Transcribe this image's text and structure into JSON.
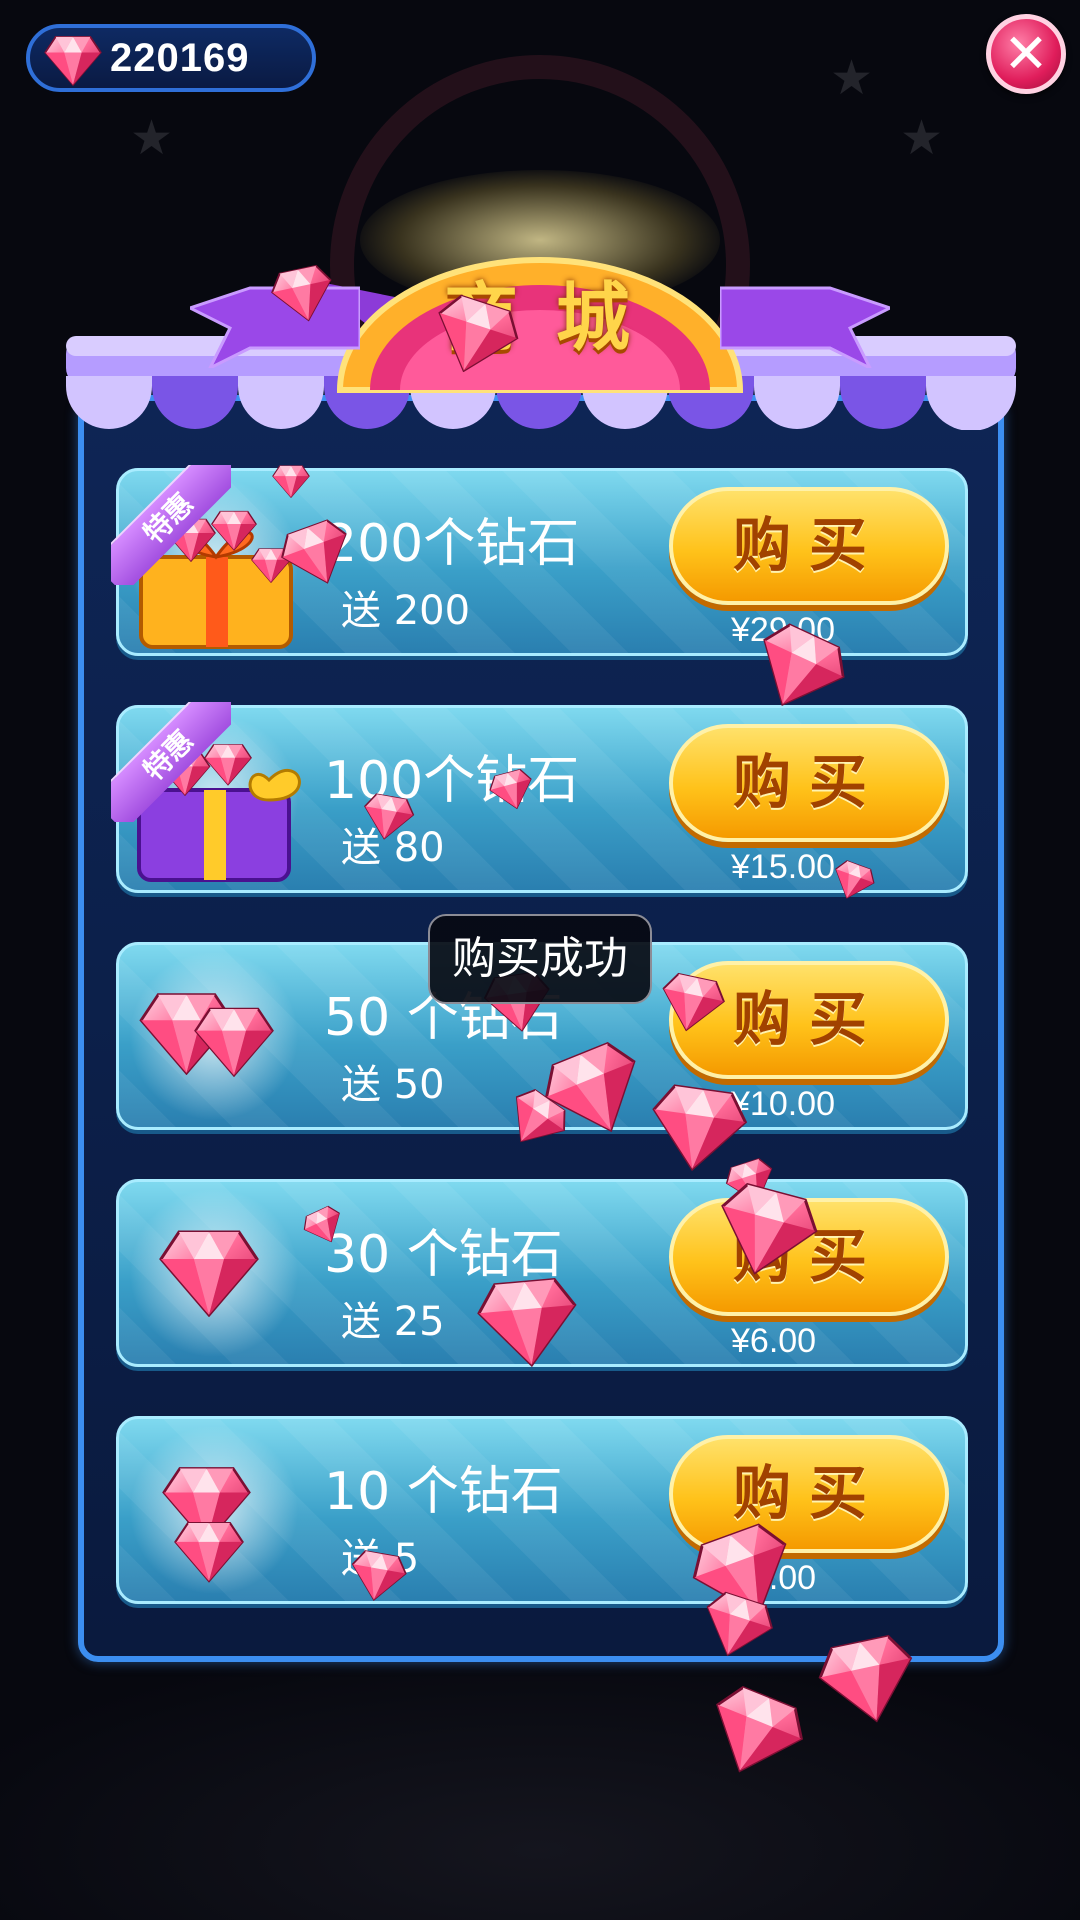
{
  "hud": {
    "gem_count": "220169"
  },
  "shop": {
    "title": "商 城",
    "offers": [
      {
        "quantity": "200个钻石",
        "bonus": "送 200",
        "buy_label": "购买",
        "price": "¥29.00",
        "badge": "特惠"
      },
      {
        "quantity": "100个钻石",
        "bonus": "送 80",
        "buy_label": "购买",
        "price": "¥15.00",
        "badge": "特惠"
      },
      {
        "quantity": "50 个钻石",
        "bonus": "送 50",
        "buy_label": "购买",
        "price": "¥10.00",
        "badge": ""
      },
      {
        "quantity": "30 个钻石",
        "bonus": "送 25",
        "buy_label": "购买",
        "price": "¥6.00",
        "badge": ""
      },
      {
        "quantity": "10 个钻石",
        "bonus": "送 5",
        "buy_label": "购买",
        "price": "¥2.00",
        "badge": ""
      }
    ]
  },
  "toast": {
    "message": "购买成功"
  },
  "colors": {
    "gem_pink": "#ff5f8f",
    "buy_button": "#ffc21a",
    "panel_border": "#3c8ef0",
    "card_blue": "#3a9fc8",
    "badge_purple": "#a24fe0"
  },
  "icons": {
    "gem": "diamond-icon",
    "close": "close-icon",
    "gift_gold": "gift-box-gold-icon",
    "gift_purple": "gift-box-purple-icon"
  }
}
